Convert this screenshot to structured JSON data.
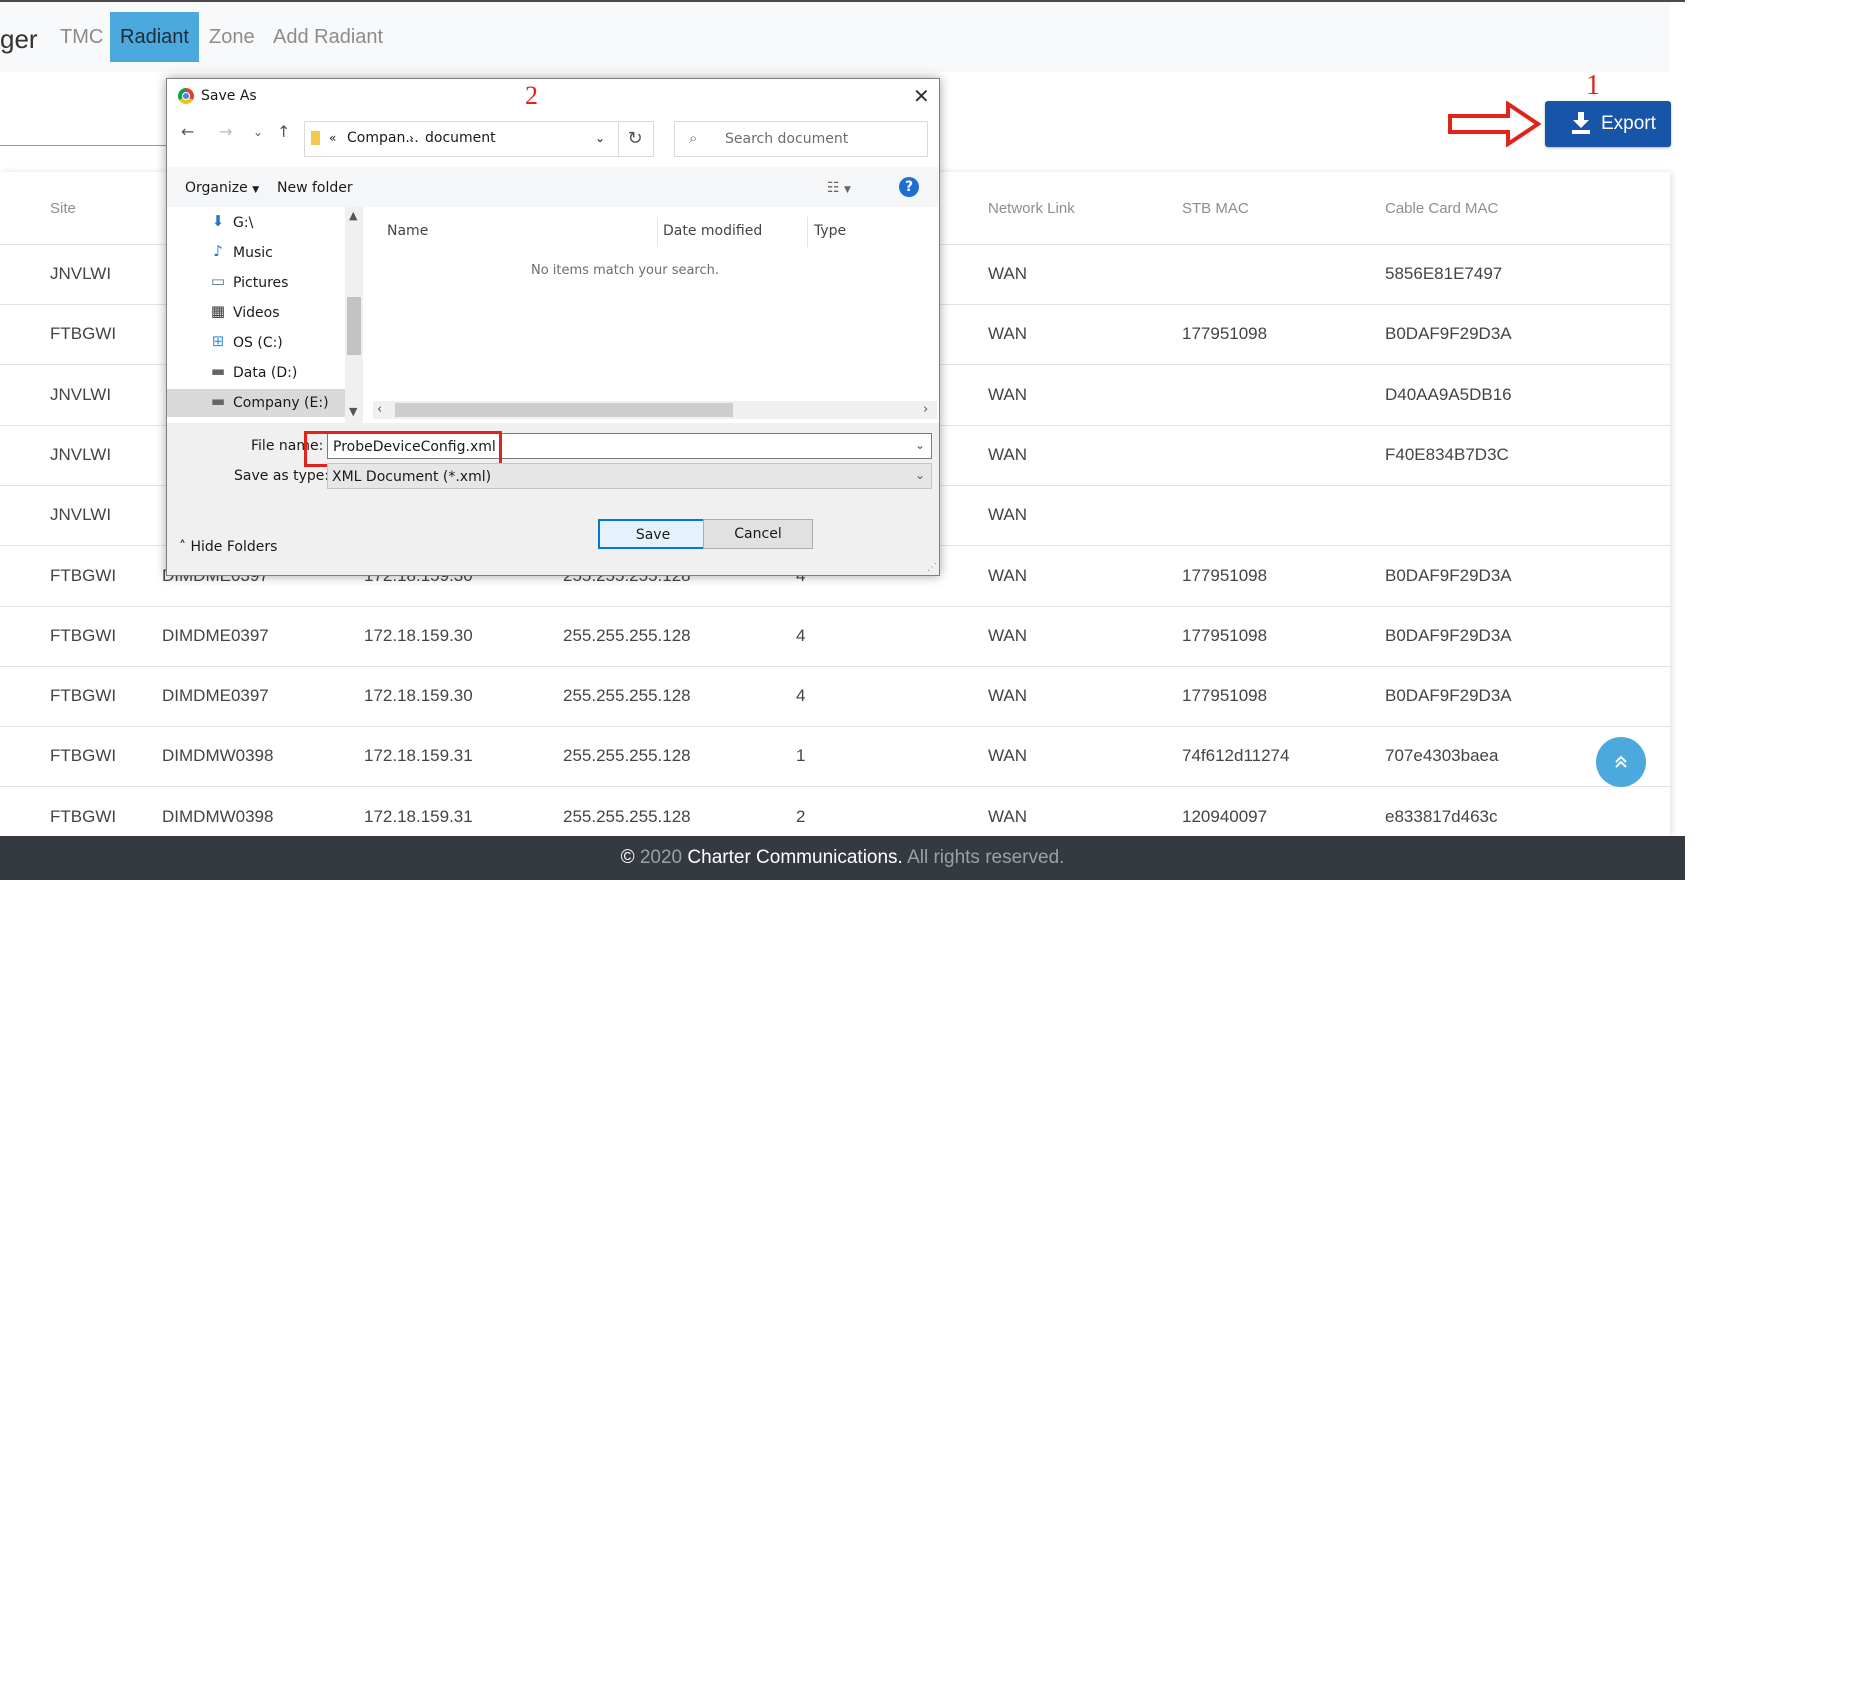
{
  "nav": {
    "brand": "ger",
    "items": [
      "TMC",
      "Radiant",
      "Zone",
      "Add Radiant"
    ],
    "active": "Radiant"
  },
  "export": {
    "label": "Export",
    "annotation": "1"
  },
  "table": {
    "headers": [
      "Site",
      "Network Link",
      "STB MAC",
      "Cable Card MAC"
    ],
    "rows": [
      [
        "JNVLWI",
        "",
        "",
        "",
        "",
        "WAN",
        "",
        "5856E81E7497"
      ],
      [
        "FTBGWI",
        "",
        "",
        "",
        "",
        "WAN",
        "177951098",
        "B0DAF9F29D3A"
      ],
      [
        "JNVLWI",
        "",
        "",
        "",
        "",
        "WAN",
        "",
        "D40AA9A5DB16"
      ],
      [
        "JNVLWI",
        "",
        "",
        "",
        "",
        "WAN",
        "",
        "F40E834B7D3C"
      ],
      [
        "JNVLWI",
        "",
        "",
        "",
        "",
        "WAN",
        "",
        ""
      ],
      [
        "FTBGWI",
        "DIMDME0397",
        "172.18.159.30",
        "255.255.255.128",
        "4",
        "WAN",
        "177951098",
        "B0DAF9F29D3A"
      ],
      [
        "FTBGWI",
        "DIMDME0397",
        "172.18.159.30",
        "255.255.255.128",
        "4",
        "WAN",
        "177951098",
        "B0DAF9F29D3A"
      ],
      [
        "FTBGWI",
        "DIMDME0397",
        "172.18.159.30",
        "255.255.255.128",
        "4",
        "WAN",
        "177951098",
        "B0DAF9F29D3A"
      ],
      [
        "FTBGWI",
        "DIMDMW0398",
        "172.18.159.31",
        "255.255.255.128",
        "1",
        "WAN",
        "74f612d11274",
        "707e4303baea"
      ],
      [
        "FTBGWI",
        "DIMDMW0398",
        "172.18.159.31",
        "255.255.255.128",
        "2",
        "WAN",
        "120940097",
        "e833817d463c"
      ]
    ]
  },
  "footer": {
    "symbol": "©",
    "year": "2020",
    "company": "Charter Communications.",
    "rights": "All rights reserved."
  },
  "dialog": {
    "title": "Save As",
    "annotation": "2",
    "path": [
      "Compan...",
      "document"
    ],
    "path_prefix": "«",
    "search_placeholder": "Search document",
    "organize": "Organize",
    "new_folder": "New folder",
    "nav_items": [
      {
        "label": "G:\\",
        "icon": "download-arrow-icon"
      },
      {
        "label": "Music",
        "icon": "music-note-icon"
      },
      {
        "label": "Pictures",
        "icon": "pictures-icon"
      },
      {
        "label": "Videos",
        "icon": "film-icon"
      },
      {
        "label": "OS (C:)",
        "icon": "windows-drive-icon"
      },
      {
        "label": "Data (D:)",
        "icon": "drive-icon"
      },
      {
        "label": "Company (E:)",
        "icon": "drive-icon"
      }
    ],
    "columns": [
      "Name",
      "Date modified",
      "Type"
    ],
    "empty_message": "No items match your search.",
    "file_name_label": "File name:",
    "file_name": "ProbeDeviceConfig.xml",
    "save_type_label": "Save as type:",
    "save_type": "XML Document (*.xml)",
    "hide_folders": "Hide Folders",
    "save": "Save",
    "cancel": "Cancel"
  },
  "colors": {
    "accent": "#4ba9dd",
    "export": "#1655a8",
    "annotation": "#e2231a",
    "footer": "#343a40"
  }
}
